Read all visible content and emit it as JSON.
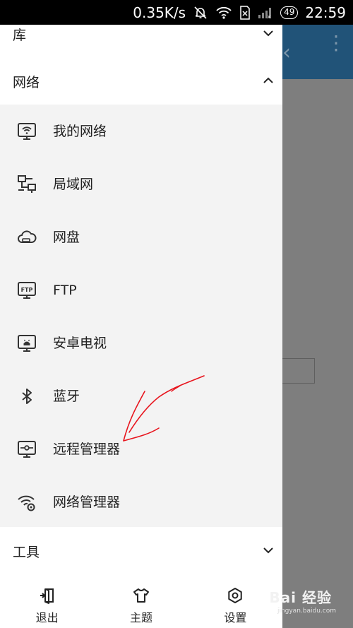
{
  "status_bar": {
    "speed": "0.35K/s",
    "battery": "49",
    "time": "22:59"
  },
  "drawer": {
    "sections": {
      "library": {
        "label": "库"
      },
      "network": {
        "label": "网络"
      },
      "tools": {
        "label": "工具"
      }
    },
    "network_items": [
      {
        "label": "我的网络",
        "icon": "monitor-wifi-icon"
      },
      {
        "label": "局域网",
        "icon": "lan-icon"
      },
      {
        "label": "网盘",
        "icon": "cloud-drive-icon"
      },
      {
        "label": "FTP",
        "icon": "ftp-icon"
      },
      {
        "label": "安卓电视",
        "icon": "android-tv-icon"
      },
      {
        "label": "蓝牙",
        "icon": "bluetooth-icon"
      },
      {
        "label": "远程管理器",
        "icon": "remote-manager-icon"
      },
      {
        "label": "网络管理器",
        "icon": "network-manager-icon"
      }
    ],
    "bottom_actions": [
      {
        "label": "退出",
        "icon": "exit-icon"
      },
      {
        "label": "主题",
        "icon": "theme-shirt-icon"
      },
      {
        "label": "设置",
        "icon": "settings-icon"
      }
    ]
  },
  "watermark": {
    "brand": "Bai 经验",
    "url": "jingyan.baidu.com"
  },
  "colors": {
    "toolbar": "#215378",
    "drawer_bg": "#ffffff",
    "submenu_bg": "#f3f3f3",
    "scrim": "#7f7f7f",
    "annotation": "#e8141d"
  }
}
